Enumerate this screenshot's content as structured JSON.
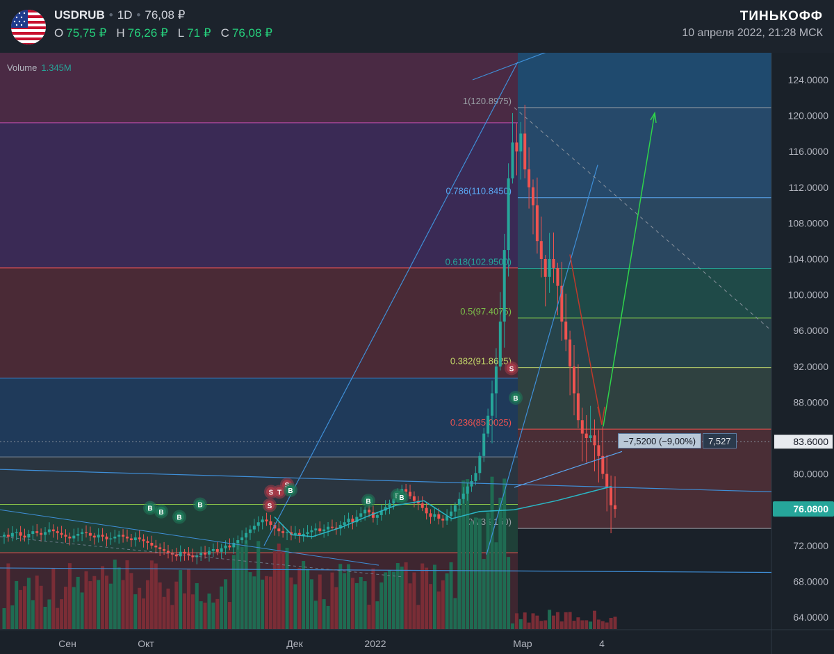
{
  "header": {
    "symbol": "USDRUB",
    "interval": "1D",
    "last_price": "76,08 ₽",
    "ohlc": {
      "o_label": "O",
      "o_value": "75,75 ₽",
      "h_label": "H",
      "h_value": "76,26 ₽",
      "l_label": "L",
      "l_value": "71 ₽",
      "c_label": "C",
      "c_value": "76,08 ₽"
    },
    "brand": "ТИНЬКОФФ",
    "datetime": "10 апреля 2022, 21:28 МСК",
    "flag_icon": "us-flag-icon"
  },
  "volume": {
    "label": "Volume",
    "value": "1.345M"
  },
  "measure": {
    "change": "−7,5200 (−9,00%)",
    "bars": "7,527"
  },
  "colors": {
    "up": "#26a69a",
    "down": "#ef5350",
    "accent_line": "#2f8ad6",
    "price_tag": "#26a69a"
  },
  "chart_data": {
    "type": "candlestick",
    "ylim": [
      62,
      127
    ],
    "y_ticks": [
      {
        "value": 124,
        "label": "124.0000"
      },
      {
        "value": 120,
        "label": "120.0000"
      },
      {
        "value": 116,
        "label": "116.0000"
      },
      {
        "value": 112,
        "label": "112.0000"
      },
      {
        "value": 108,
        "label": "108.0000"
      },
      {
        "value": 104,
        "label": "104.0000"
      },
      {
        "value": 100,
        "label": "100.0000"
      },
      {
        "value": 96,
        "label": "96.0000"
      },
      {
        "value": 92,
        "label": "92.0000"
      },
      {
        "value": 88,
        "label": "88.0000"
      },
      {
        "value": 83.6,
        "label": "83.6000"
      },
      {
        "value": 80,
        "label": "80.0000"
      },
      {
        "value": 72,
        "label": "72.0000"
      },
      {
        "value": 68,
        "label": "68.0000"
      },
      {
        "value": 64,
        "label": "64.0000"
      }
    ],
    "last_price_tag": {
      "value": 76.08,
      "label": "76.0800"
    },
    "x_ticks": [
      "Сен",
      "Окт",
      "Дек",
      "2022",
      "Мар",
      "4"
    ],
    "fib_levels": [
      {
        "ratio": "1",
        "price": 120.8975,
        "label": "1(120.8975)",
        "color": "#9aa0a6"
      },
      {
        "ratio": "0.786",
        "price": 110.845,
        "label": "0.786(110.8450)",
        "color": "#5aa6f0"
      },
      {
        "ratio": "0.618",
        "price": 102.95,
        "label": "0.618(102.9500)",
        "color": "#26a69a"
      },
      {
        "ratio": "0.5",
        "price": 97.4075,
        "label": "0.5(97.4075)",
        "color": "#7cc24a"
      },
      {
        "ratio": "0.382",
        "price": 91.8625,
        "label": "0.382(91.8625)",
        "color": "#c3d86a"
      },
      {
        "ratio": "0.236",
        "price": 85.0025,
        "label": "0.236(85.0025)",
        "color": "#ef5350"
      },
      {
        "ratio": "0",
        "price": 73.915,
        "label": "0(73.9150)",
        "color": "#9aa0a6"
      }
    ],
    "markers": [
      {
        "label": "B",
        "date": "Oct",
        "price": 76.2
      },
      {
        "label": "B",
        "date": "Oct",
        "price": 75.8
      },
      {
        "label": "B",
        "date": "Oct",
        "price": 75.2
      },
      {
        "label": "B",
        "date": "Oct",
        "price": 76.6
      },
      {
        "label": "S",
        "date": "Nov",
        "price": 76.5
      },
      {
        "label": "S",
        "date": "Nov",
        "price": 78.0
      },
      {
        "label": "T",
        "date": "Nov",
        "price": 78.0
      },
      {
        "label": "S",
        "date": "Nov",
        "price": 78.8
      },
      {
        "label": "B",
        "date": "Nov",
        "price": 78.2
      },
      {
        "label": "B",
        "date": "Jan",
        "price": 77.0
      },
      {
        "label": "B",
        "date": "Jan",
        "price": 77.6
      },
      {
        "label": "B",
        "date": "Jan",
        "price": 77.4
      },
      {
        "label": "B",
        "date": "Feb",
        "price": 88.5
      },
      {
        "label": "S",
        "date": "Feb",
        "price": 91.8
      }
    ],
    "closes": [
      73.2,
      73.0,
      73.4,
      73.5,
      73.1,
      72.9,
      73.3,
      73.6,
      73.4,
      73.2,
      73.5,
      73.8,
      73.6,
      73.4,
      73.2,
      73.0,
      72.8,
      73.1,
      73.3,
      73.5,
      73.4,
      73.1,
      72.9,
      73.2,
      73.0,
      72.7,
      72.8,
      73.0,
      73.2,
      73.0,
      72.8,
      72.6,
      72.9,
      72.7,
      72.5,
      72.3,
      72.0,
      71.8,
      71.6,
      71.4,
      71.2,
      71.0,
      70.8,
      71.3,
      71.1,
      70.9,
      70.7,
      70.9,
      71.2,
      71.0,
      71.4,
      71.6,
      71.3,
      71.7,
      72.0,
      71.8,
      72.3,
      72.6,
      72.9,
      73.4,
      73.8,
      74.2,
      74.6,
      74.9,
      74.7,
      74.3,
      73.9,
      73.6,
      73.4,
      73.5,
      73.2,
      73.4,
      73.1,
      73.3,
      73.5,
      73.7,
      73.9,
      73.6,
      73.8,
      74.1,
      74.0,
      73.9,
      74.3,
      74.6,
      75.0,
      74.6,
      75.2,
      75.6,
      76.0,
      75.7,
      75.1,
      75.4,
      75.9,
      76.3,
      76.7,
      77.2,
      77.6,
      78.3,
      78.0,
      77.5,
      77.0,
      76.7,
      76.2,
      75.6,
      75.2,
      75.5,
      75.0,
      74.8,
      75.3,
      75.8,
      76.5,
      77.2,
      77.8,
      78.6,
      79.2,
      80.1,
      82.0,
      84.5,
      86.5,
      89.0,
      92.0,
      97.0,
      105.0,
      113.0,
      117.0,
      116.0,
      118.0,
      114.0,
      112.0,
      110.0,
      106.0,
      104.0,
      102.0,
      104.0,
      103.0,
      101.0,
      97.0,
      95.0,
      92.0,
      89.0,
      86.0,
      84.5,
      84.0,
      84.3,
      83.2,
      82.0,
      80.0,
      78.5,
      76.5,
      76.08
    ],
    "annotations": [
      "arrow down to 0.236 level",
      "arrow up to 120"
    ]
  }
}
